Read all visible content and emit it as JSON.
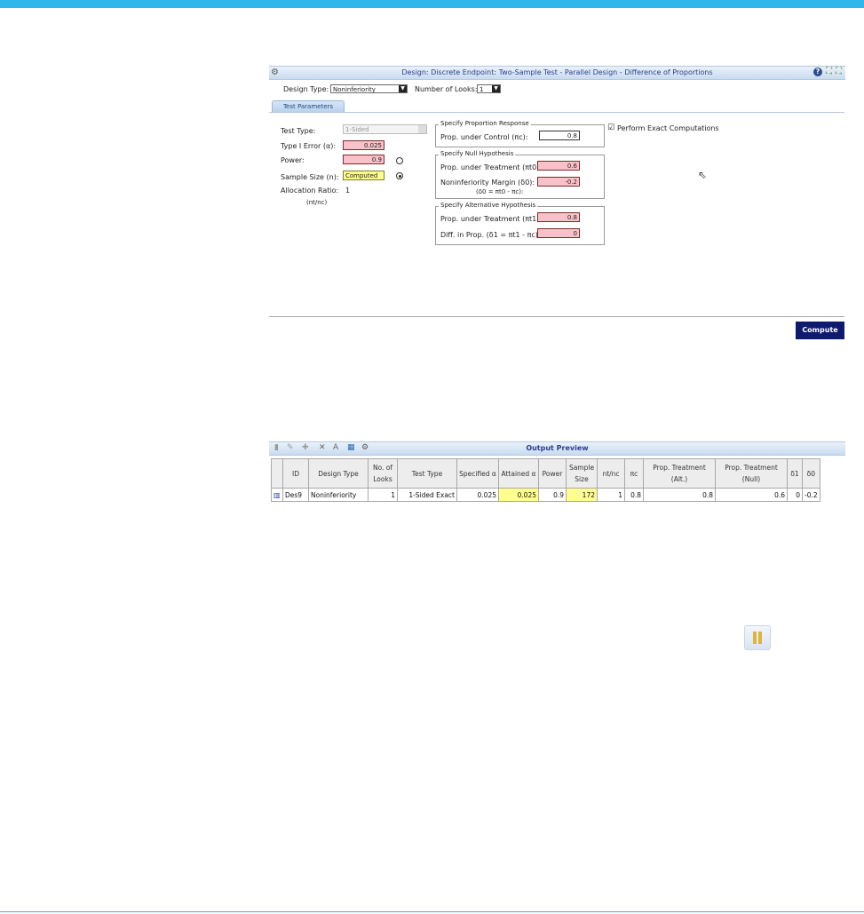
{
  "design": {
    "title": "Design: Discrete Endpoint: Two-Sample Test - Parallel Design - Difference of Proportions",
    "design_type_label": "Design Type:",
    "design_type_value": "Noninferiority",
    "num_looks_label": "Number of Looks:",
    "num_looks_value": "1",
    "tab_label": "Test Parameters",
    "help_icon_text": "?",
    "icons": [
      "gear-icon",
      "help-icon",
      "expand-icon",
      "collapse-icon"
    ]
  },
  "params": {
    "test_type_label": "Test Type:",
    "test_type_value": "1-Sided",
    "type1_error_label": "Type I Error (α):",
    "type1_error_value": "0.025",
    "power_label": "Power:",
    "power_value": "0.9",
    "sample_size_label": "Sample Size (n):",
    "sample_size_value": "Computed",
    "allocation_label": "Allocation Ratio:",
    "allocation_value": "1",
    "allocation_sub": "(nt/nc)",
    "exact_label": "Perform Exact Computations",
    "exact_checked": "☑"
  },
  "proportion_response": {
    "group_title": "Specify Proportion Response",
    "control_label": "Prop. under Control (πc):",
    "control_value": "0.8"
  },
  "null_hypothesis": {
    "group_title": "Specify Null Hypothesis",
    "treatment_label": "Prop. under Treatment (πt0):",
    "treatment_value": "0.6",
    "margin_label": "Noninferiority Margin (δ0):",
    "margin_formula": "(δ0 = πt0 - πc):",
    "margin_value": "-0.2"
  },
  "alt_hypothesis": {
    "group_title": "Specify Alternative Hypothesis",
    "treatment_label": "Prop. under Treatment (πt1):",
    "treatment_value": "0.8",
    "diff_label": "Diff. in Prop. (δ1 = πt1 - πc):",
    "diff_value": "0"
  },
  "compute_label": "Compute",
  "output": {
    "title": "Output Preview",
    "toolbar_icons": [
      "save-icon",
      "edit-icon",
      "add-icon",
      "delete-icon",
      "rename-icon",
      "table-icon",
      "settings-icon"
    ],
    "columns": [
      "",
      "ID",
      "Design Type",
      "No. of Looks",
      "Test Type",
      "Specified α",
      "Attained α",
      "Power",
      "Sample Size",
      "nt/nc",
      "πc",
      "Prop. Treatment (Alt.)",
      "Prop. Treatment (Null)",
      "δ1",
      "δ0"
    ],
    "row": [
      "",
      "Des9",
      "Noninferiority",
      "1",
      "1-Sided Exact",
      "0.025",
      "0.025",
      "0.9",
      "172",
      "1",
      "0.8",
      "0.8",
      "0.6",
      "0",
      "-0.2"
    ]
  },
  "colors": {
    "accent": "#2eb7ec",
    "title_bar_text": "#2a3e8f",
    "required_field": "#f9c1c9",
    "computed_field": "#ffff8f",
    "compute_button": "#0e1a70"
  }
}
